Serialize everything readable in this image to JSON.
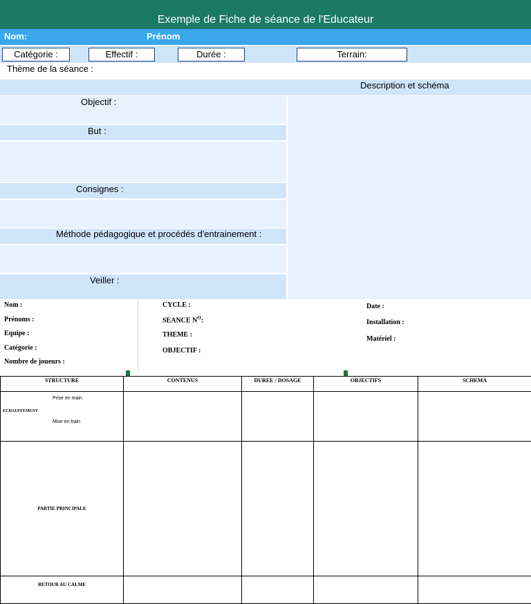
{
  "header": {
    "title": "Exemple de Fiche de séance de l'Educateur",
    "nom_label": "Nom:",
    "prenom_label": "Prénom"
  },
  "info": {
    "categorie": "Catégorie :",
    "effectif": "Effectif :",
    "duree": "Durée :",
    "terrain": "Terrain:"
  },
  "theme_label": "Thème de la séance :",
  "description_label": "Description et schéma",
  "sections": {
    "objectif": "Objectif :",
    "but": "But :",
    "consignes": "Consignes :",
    "methode": "Méthode pédagogique et  procédés d'entrainement :",
    "veiller": "Veiller :"
  },
  "form2": {
    "col1": [
      "Nom :",
      "Prénoms :",
      "Equipe :",
      "Catégorie :",
      "Nombre de joueurs :"
    ],
    "col2": {
      "cycle": "CYCLE :",
      "seance": "SEANCE N",
      "seance_sup": "O",
      "seance_colon": ":",
      "theme": "THEME :",
      "objectif": "OBJECTIF :"
    },
    "col3": [
      "Date :",
      "Installation :",
      "Matériel :"
    ]
  },
  "table": {
    "headers": [
      "STRUCTURE",
      "CONTENUS",
      "DUREE / DOSAGE",
      "OBJECTIFS",
      "SCHEMA"
    ],
    "rows": {
      "echauffement": "ECHAUFFEMENT",
      "prise_en_main": "Prise en main",
      "mise_en_train": "Mise en train",
      "partie_principale": "PARTIE PRINCIPALE",
      "retour_au_calme": "RETOUR AU CALME"
    }
  }
}
